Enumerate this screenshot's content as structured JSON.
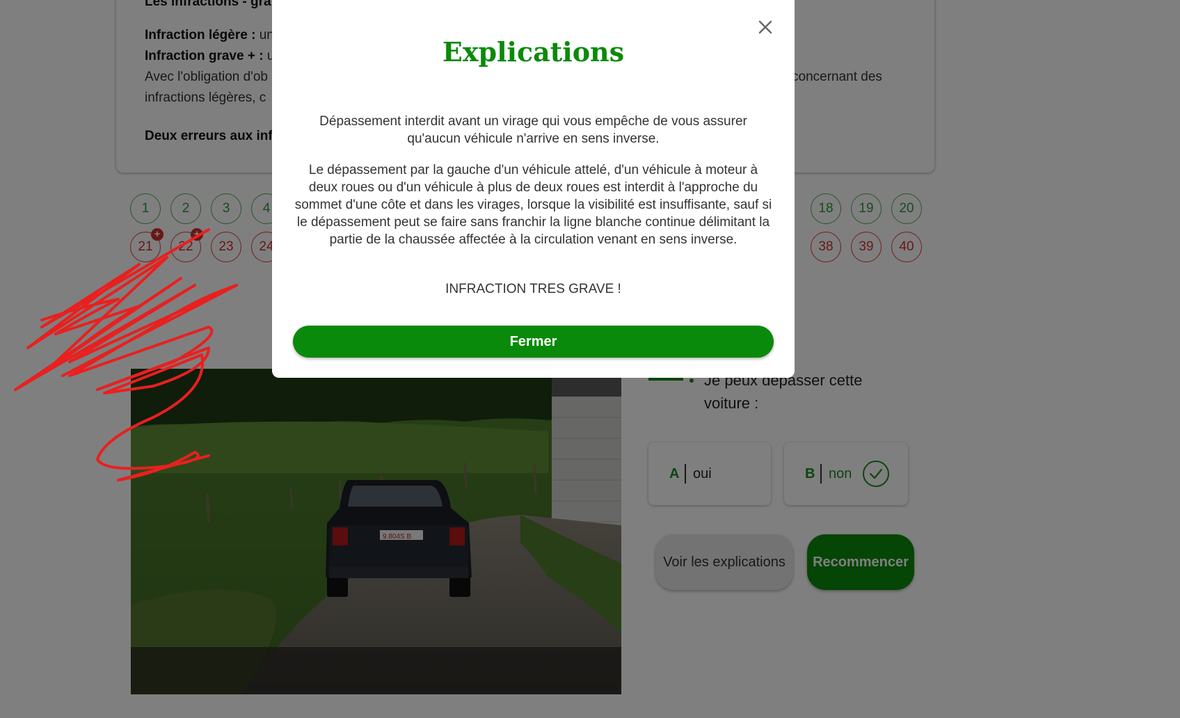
{
  "info": {
    "line0_cut": "Les infractions - gra",
    "light_label": "Infraction légère : ",
    "light_tail": "un",
    "grave_label": "Infraction grave + : ",
    "grave_tail": "u",
    "obligation_head": "Avec l'obligation d'ob",
    "obligation_tail": "concernant des",
    "infractions_head": "infractions légères, c",
    "two_errors": "Deux erreurs aux inf"
  },
  "questions": {
    "row1": [
      {
        "n": "1",
        "status": "good"
      },
      {
        "n": "2",
        "status": "good"
      },
      {
        "n": "3",
        "status": "good"
      },
      {
        "n": "4",
        "status": "good"
      },
      {
        "n": "18",
        "status": "good"
      },
      {
        "n": "19",
        "status": "good"
      },
      {
        "n": "20",
        "status": "good"
      }
    ],
    "row2": [
      {
        "n": "21",
        "status": "bad",
        "badge": "+"
      },
      {
        "n": "22",
        "status": "bad",
        "badge": "+"
      },
      {
        "n": "23",
        "status": "bad"
      },
      {
        "n": "24",
        "status": "bad"
      },
      {
        "n": "38",
        "status": "bad"
      },
      {
        "n": "39",
        "status": "bad"
      },
      {
        "n": "40",
        "status": "bad"
      }
    ]
  },
  "question": {
    "text": "Je peux dépasser cette voiture :",
    "answers": [
      {
        "letter": "A",
        "label": "oui"
      },
      {
        "letter": "B",
        "label": "non",
        "correct": true
      }
    ],
    "explain_button": "Voir les explications",
    "restart_button": "Recommencer"
  },
  "modal": {
    "title": "Explications",
    "para1": "Dépassement interdit avant un virage qui vous empêche de vous assurer qu'aucun véhicule n'arrive en sens inverse.",
    "para2": "Le dépassement par la gauche d'un véhicule attelé, d'un véhicule à moteur à deux roues ou d'un véhicule à plus de deux roues est interdit à l'approche du sommet d'une côte et dans les virages, lorsque la visibilité est insuffisante, sauf si le dépassement peut se faire sans franchir la ligne blanche continue délimitant la partie de la chaussée affectée à la circulation venant en sens inverse.",
    "para3": "INFRACTION TRES GRAVE !",
    "close_button": "Fermer"
  },
  "photo": {
    "plate": "9.804S B"
  },
  "colors": {
    "brand_green": "#0a8a0a",
    "error_red": "#d32f2f",
    "scribble_red": "#e8201f"
  }
}
